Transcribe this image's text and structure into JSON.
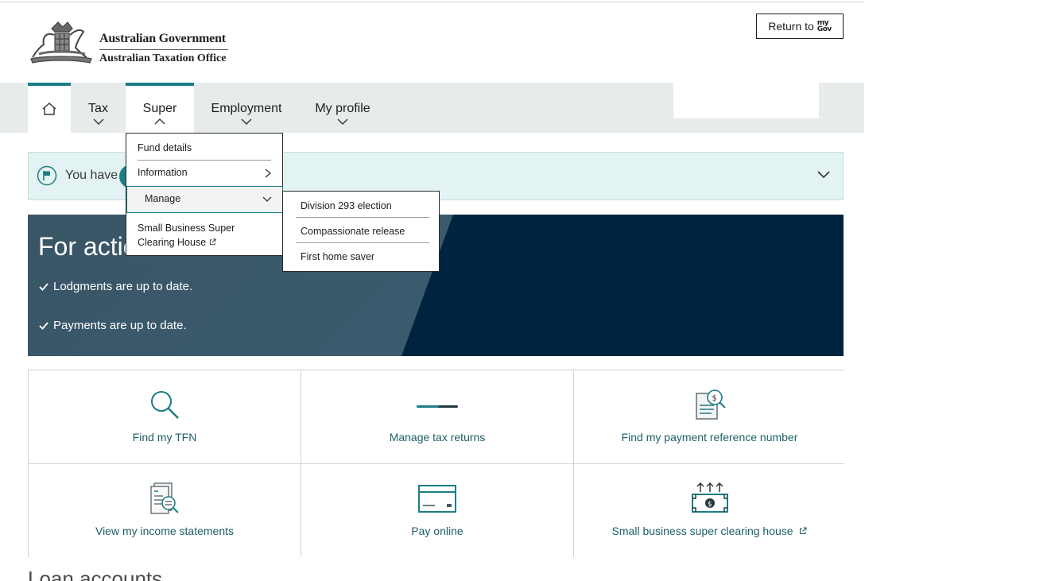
{
  "header": {
    "gov_line": "Australian Government",
    "agency_line": "Australian Taxation Office",
    "return_label": "Return to",
    "mygov_top": "my",
    "mygov_bottom": "Gov"
  },
  "nav": {
    "home_icon": "home-icon",
    "items": [
      {
        "label": "Tax"
      },
      {
        "label": "Super"
      },
      {
        "label": "Employment"
      },
      {
        "label": "My profile"
      }
    ]
  },
  "super_menu": {
    "items": [
      {
        "label": "Fund details"
      },
      {
        "label": "Information"
      },
      {
        "label": "Manage"
      },
      {
        "label": "Small Business Super Clearing House"
      }
    ],
    "submenu": [
      {
        "label": "Division 293 election"
      },
      {
        "label": "Compassionate release"
      },
      {
        "label": "First home saver"
      }
    ]
  },
  "notice": {
    "text": "You have"
  },
  "hero": {
    "title": "For action",
    "items": [
      "Lodgments are up to date.",
      "Payments are up to date."
    ]
  },
  "tiles": [
    {
      "label": "Find my TFN",
      "icon": "magnifier-icon"
    },
    {
      "label": "Manage tax returns",
      "icon": "loading-bar-icon"
    },
    {
      "label": "Find my payment reference number",
      "icon": "document-dollar-search-icon"
    },
    {
      "label": "View my income statements",
      "icon": "statement-search-icon"
    },
    {
      "label": "Pay online",
      "icon": "credit-card-icon"
    },
    {
      "label": "Small business super clearing house",
      "icon": "banknote-upload-icon"
    }
  ],
  "section": {
    "loan_heading": "Loan accounts"
  },
  "colors": {
    "accent": "#1c7d83",
    "nav_bg": "#e8ebeb",
    "hero_dark": "#00233f",
    "notice_bg": "#e3f2f2"
  }
}
